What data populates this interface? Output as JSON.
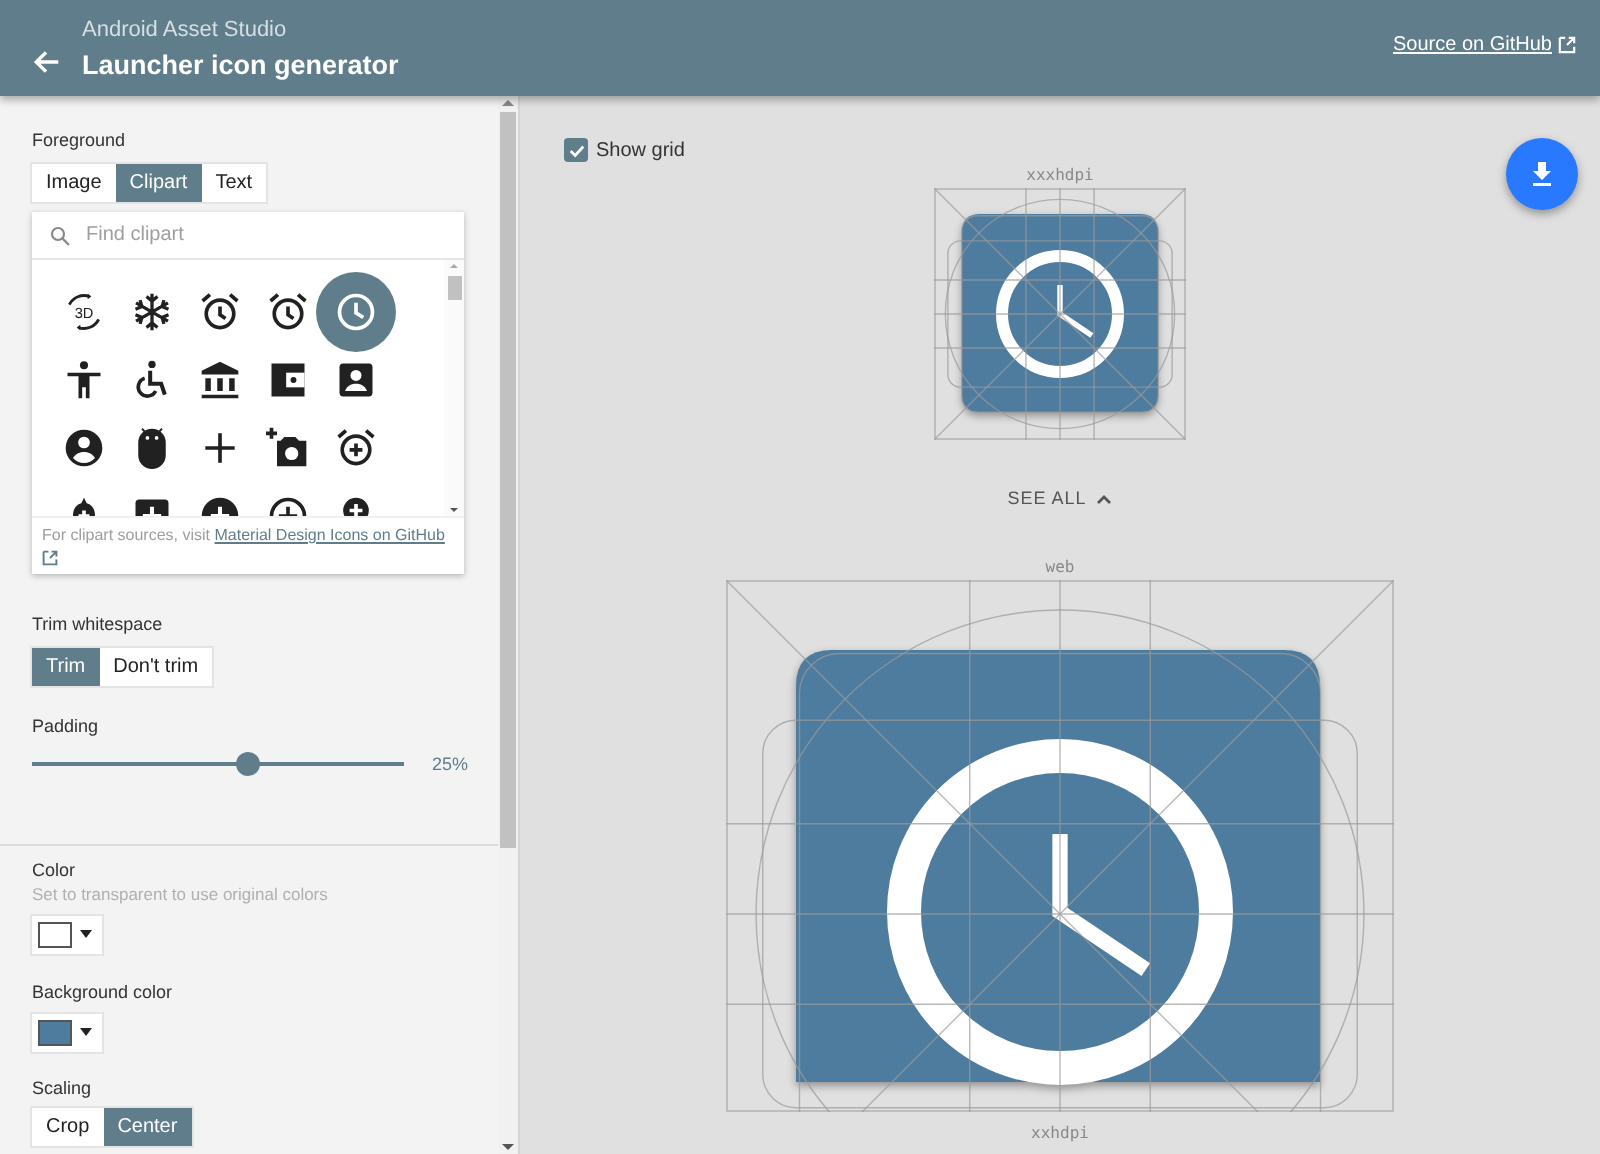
{
  "header": {
    "subtitle": "Android Asset Studio",
    "title": "Launcher icon generator",
    "link": "Source on GitHub"
  },
  "sidebar": {
    "foreground": {
      "label": "Foreground",
      "tabs": [
        {
          "label": "Image",
          "selected": false
        },
        {
          "label": "Clipart",
          "selected": true
        },
        {
          "label": "Text",
          "selected": false
        }
      ],
      "clipart": {
        "placeholder": "Find clipart",
        "items": [
          {
            "kind": "rotation-3d",
            "label": "3D",
            "selected": false
          },
          {
            "kind": "snowflake",
            "selected": false
          },
          {
            "kind": "alarm",
            "selected": false
          },
          {
            "kind": "alarm",
            "selected": false
          },
          {
            "kind": "clock",
            "selected": true
          },
          {
            "kind": "person",
            "selected": false
          },
          {
            "kind": "wheelchair",
            "selected": false
          },
          {
            "kind": "bank",
            "selected": false
          },
          {
            "kind": "wallet",
            "selected": false
          },
          {
            "kind": "account-box",
            "selected": false
          },
          {
            "kind": "account-circle",
            "selected": false
          },
          {
            "kind": "android",
            "selected": false
          },
          {
            "kind": "plus",
            "selected": false
          },
          {
            "kind": "add-photo",
            "selected": false
          },
          {
            "kind": "alarm-add",
            "selected": false
          },
          {
            "kind": "alert-add",
            "selected": false
          },
          {
            "kind": "add-box",
            "selected": false
          },
          {
            "kind": "add-circle",
            "selected": false
          },
          {
            "kind": "add-circle-outline",
            "selected": false
          },
          {
            "kind": "add-location",
            "selected": false
          }
        ],
        "note": "For clipart sources, visit ",
        "note_link": "Material Design Icons on GitHub"
      }
    },
    "trim": {
      "label": "Trim whitespace",
      "options": [
        {
          "label": "Trim",
          "selected": true
        },
        {
          "label": "Don't trim",
          "selected": false
        }
      ]
    },
    "padding": {
      "label": "Padding",
      "level": 0.58,
      "reading": "25%"
    },
    "color": {
      "label": "Color",
      "hint": "Set to transparent to use original colors",
      "color": "#ffffff"
    },
    "background_color": {
      "label": "Background color",
      "color": "#4e7c9f"
    },
    "scaling": {
      "label": "Scaling",
      "options": [
        {
          "label": "Crop",
          "selected": false
        },
        {
          "label": "Center",
          "selected": true
        }
      ]
    }
  },
  "preview": {
    "show_grid": {
      "label": "Show grid",
      "checked": true
    },
    "main": {
      "label": "xxxhdpi"
    },
    "see_all": "SEE ALL",
    "all": [
      {
        "label": "web",
        "kind": "web"
      },
      {
        "label": "xxhdpi",
        "kind": "density"
      }
    ]
  }
}
